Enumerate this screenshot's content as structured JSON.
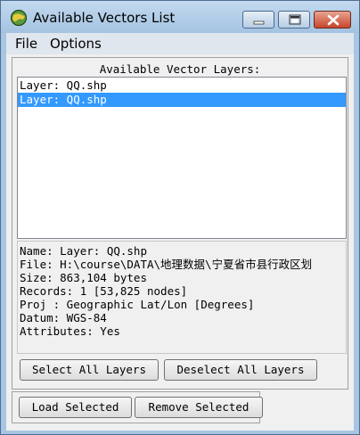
{
  "window": {
    "title": "Available Vectors List",
    "icon": "app-globe-icon",
    "controls": [
      "minimize-icon",
      "maximize-icon",
      "close-icon"
    ]
  },
  "menu": {
    "file": "File",
    "options": "Options"
  },
  "layers_panel": {
    "heading": "Available Vector Layers:",
    "items": [
      {
        "label": "Layer: QQ.shp",
        "selected": false
      },
      {
        "label": "Layer: QQ.shp",
        "selected": true
      }
    ]
  },
  "info": {
    "lines": [
      "Name: Layer: QQ.shp",
      "File: H:\\course\\DATA\\地理数据\\宁夏省市县行政区划",
      "Size: 863,104 bytes",
      "Records: 1 [53,825 nodes]",
      "Proj : Geographic Lat/Lon [Degrees]",
      "Datum: WGS-84",
      "Attributes: Yes"
    ]
  },
  "buttons": {
    "select_all": "Select All Layers",
    "deselect_all": "Deselect All Layers",
    "load_selected": "Load Selected",
    "remove_selected": "Remove Selected"
  },
  "colors": {
    "selection": "#3399ff",
    "titlebar": "#a8c6e2",
    "close_button": "#c7452c"
  }
}
